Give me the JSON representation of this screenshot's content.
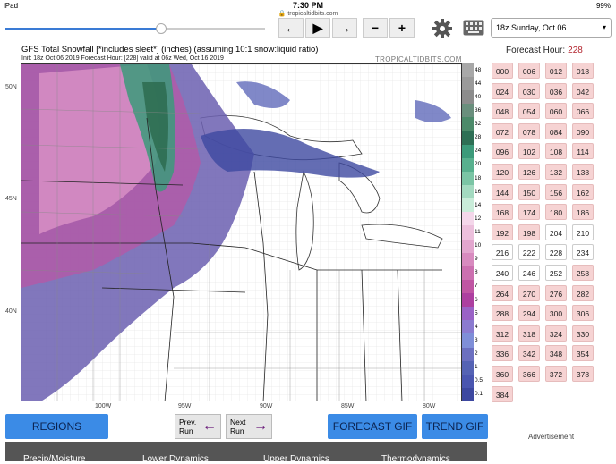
{
  "status": {
    "device": "iPad",
    "time": "7:30 PM",
    "battery": "99%",
    "url": "tropicaltidbits.com"
  },
  "controls": {
    "prev_symbol": "←",
    "play_symbol": "▶",
    "next_symbol": "→",
    "minus_symbol": "−",
    "plus_symbol": "+",
    "run_select": "18z Sunday, Oct 06",
    "slider_progress": 0.6
  },
  "map": {
    "title": "GFS Total Snowfall [*includes sleet*] (inches) (assuming 10:1 snow:liquid ratio)",
    "init": "Init: 18z Oct 06 2019     Forecast Hour: [228]   valid at 06z Wed, Oct 16 2019",
    "brand": "TROPICALTIDBITS.COM",
    "lat_labels": [
      "50N",
      "45N",
      "40N"
    ],
    "lon_labels": [
      "100W",
      "95W",
      "90W",
      "85W",
      "80W"
    ],
    "colorbar_ticks": [
      "48",
      "44",
      "40",
      "36",
      "32",
      "28",
      "24",
      "20",
      "18",
      "16",
      "14",
      "12",
      "11",
      "10",
      "9",
      "8",
      "7",
      "6",
      "5",
      "4",
      "3",
      "2",
      "1",
      "0.5",
      "0.1"
    ]
  },
  "forecast": {
    "label": "Forecast Hour:",
    "current": "228",
    "hours": [
      "000",
      "006",
      "012",
      "018",
      "024",
      "030",
      "036",
      "042",
      "048",
      "054",
      "060",
      "066",
      "072",
      "078",
      "084",
      "090",
      "096",
      "102",
      "108",
      "114",
      "120",
      "126",
      "132",
      "138",
      "144",
      "150",
      "156",
      "162",
      "168",
      "174",
      "180",
      "186",
      "192",
      "198",
      "204",
      "210",
      "216",
      "222",
      "228",
      "234",
      "240",
      "246",
      "252",
      "258",
      "264",
      "270",
      "276",
      "282",
      "288",
      "294",
      "300",
      "306",
      "312",
      "318",
      "324",
      "330",
      "336",
      "342",
      "348",
      "354",
      "360",
      "366",
      "372",
      "378",
      "384"
    ]
  },
  "buttons": {
    "regions": "REGIONS",
    "prev_run_line1": "Prev.",
    "prev_run_line2": "Run",
    "next_run_line1": "Next",
    "next_run_line2": "Run",
    "prev_arrow": "←",
    "next_arrow": "→",
    "forecast_gif": "FORECAST GIF",
    "trend_gif": "TREND GIF"
  },
  "advertisement": "Advertisement",
  "tabs": [
    "Precip/Moisture",
    "Lower Dynamics",
    "Upper Dynamics",
    "Thermodynamics"
  ]
}
